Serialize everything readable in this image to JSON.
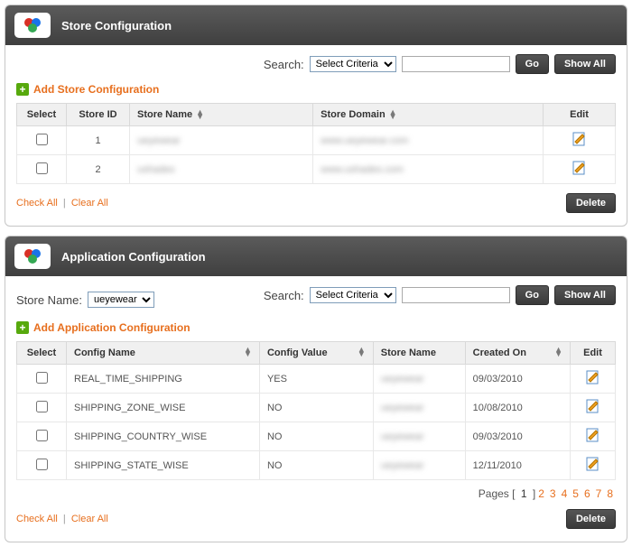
{
  "common": {
    "search_label": "Search:",
    "select_criteria": "Select Criteria",
    "go": "Go",
    "show_all": "Show All",
    "check_all": "Check All",
    "clear_all": "Clear All",
    "delete": "Delete",
    "edit_header": "Edit",
    "select_header": "Select"
  },
  "store_panel": {
    "title": "Store Configuration",
    "add_label": "Add Store Configuration",
    "columns": {
      "store_id": "Store ID",
      "store_name": "Store Name",
      "store_domain": "Store Domain"
    },
    "rows": [
      {
        "id": "1",
        "name": "ueyewear",
        "domain": "www.ueyewear.com"
      },
      {
        "id": "2",
        "name": "ushades",
        "domain": "www.ushades.com"
      }
    ]
  },
  "app_panel": {
    "title": "Application Configuration",
    "store_name_label": "Store Name:",
    "store_name_value": "ueyewear",
    "add_label": "Add Application Configuration",
    "columns": {
      "config_name": "Config Name",
      "config_value": "Config Value",
      "store_name": "Store Name",
      "created_on": "Created On"
    },
    "rows": [
      {
        "name": "REAL_TIME_SHIPPING",
        "value": "YES",
        "store": "ueyewear",
        "created": "09/03/2010"
      },
      {
        "name": "SHIPPING_ZONE_WISE",
        "value": "NO",
        "store": "ueyewear",
        "created": "10/08/2010"
      },
      {
        "name": "SHIPPING_COUNTRY_WISE",
        "value": "NO",
        "store": "ueyewear",
        "created": "09/03/2010"
      },
      {
        "name": "SHIPPING_STATE_WISE",
        "value": "NO",
        "store": "ueyewear",
        "created": "12/11/2010"
      }
    ],
    "pages_label": "Pages",
    "current_page": 1,
    "total_pages": 8
  }
}
